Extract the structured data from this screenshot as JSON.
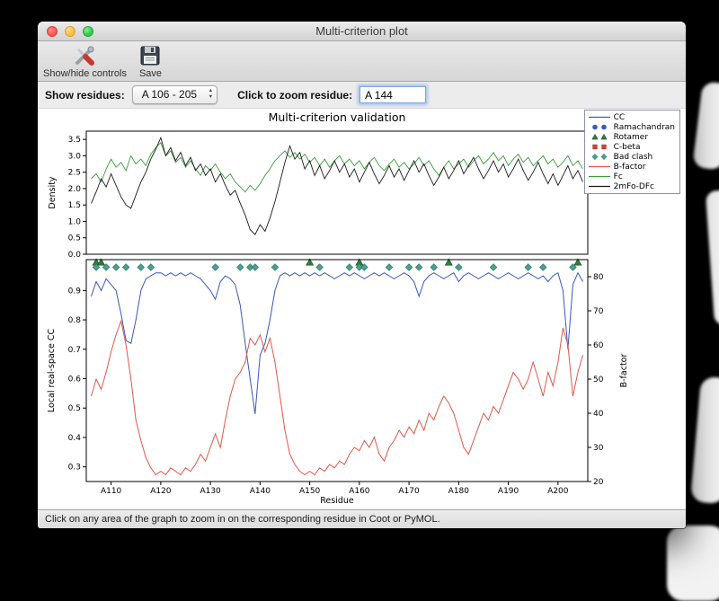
{
  "window": {
    "title": "Multi-criterion plot",
    "toolbar": {
      "show_hide_label": "Show/hide controls",
      "save_label": "Save"
    },
    "controls": {
      "show_residues_label": "Show residues:",
      "residue_range_value": "A 106 - 205",
      "zoom_residue_label": "Click to zoom residue:",
      "zoom_residue_value": "A 144"
    },
    "status_text": "Click on any area of the graph to zoom in on the corresponding residue in Coot or PyMOL."
  },
  "chart_data": {
    "type": "line",
    "title": "Multi-criterion validation",
    "xlabel": "Residue",
    "x_start": 106,
    "xlim": [
      105,
      206
    ],
    "x_ticks": {
      "values": [
        110,
        120,
        130,
        140,
        150,
        160,
        170,
        180,
        190,
        200
      ],
      "labels": [
        "A110",
        "A120",
        "A130",
        "A140",
        "A150",
        "A160",
        "A170",
        "A180",
        "A190",
        "A200"
      ]
    },
    "top_plot": {
      "ylabel": "Density",
      "ylim": [
        0,
        3.75
      ],
      "yticks": [
        "0.0",
        "0.5",
        "1.0",
        "1.5",
        "2.0",
        "2.5",
        "3.0",
        "3.5"
      ],
      "series": [
        {
          "name": "Fc",
          "color": "#3c9a3c",
          "values": [
            2.3,
            2.45,
            2.2,
            2.6,
            2.9,
            2.65,
            2.8,
            2.55,
            3.0,
            2.75,
            2.9,
            2.7,
            3.05,
            3.25,
            3.4,
            3.0,
            3.15,
            2.8,
            2.95,
            2.65,
            2.85,
            2.6,
            2.4,
            2.7,
            2.55,
            2.75,
            2.5,
            2.3,
            2.45,
            2.2,
            2.05,
            1.9,
            2.1,
            1.95,
            2.15,
            2.4,
            2.6,
            2.85,
            3.0,
            3.15,
            2.95,
            3.1,
            2.9,
            3.05,
            2.8,
            2.95,
            2.7,
            2.9,
            2.65,
            2.85,
            3.0,
            2.75,
            2.9,
            2.7,
            2.85,
            2.6,
            2.8,
            2.95,
            2.7,
            2.55,
            2.75,
            2.9,
            2.65,
            2.8,
            2.6,
            2.75,
            2.95,
            2.7,
            2.85,
            2.6,
            2.4,
            2.65,
            2.85,
            2.6,
            2.75,
            2.9,
            2.65,
            2.85,
            3.0,
            2.75,
            2.9,
            3.1,
            2.85,
            3.0,
            2.7,
            2.9,
            3.05,
            2.8,
            2.95,
            2.7,
            2.85,
            3.0,
            2.75,
            2.9,
            2.65,
            2.8,
            3.0,
            2.7,
            2.85,
            2.6
          ]
        },
        {
          "name": "2mFo-DFc",
          "color": "#1a1a1a",
          "values": [
            1.55,
            1.9,
            2.3,
            2.05,
            2.45,
            2.1,
            1.75,
            1.5,
            1.4,
            1.8,
            2.2,
            2.5,
            2.9,
            3.2,
            3.55,
            3.0,
            3.25,
            2.85,
            3.1,
            2.7,
            2.95,
            2.55,
            2.75,
            2.4,
            2.6,
            2.2,
            2.45,
            2.1,
            1.8,
            1.95,
            1.55,
            1.2,
            0.75,
            0.6,
            0.9,
            0.7,
            1.1,
            1.6,
            2.2,
            2.8,
            3.3,
            2.9,
            3.1,
            2.6,
            2.85,
            2.4,
            2.7,
            2.3,
            2.55,
            2.85,
            2.5,
            2.75,
            2.35,
            2.6,
            2.2,
            2.5,
            2.8,
            2.45,
            2.15,
            2.4,
            2.7,
            2.35,
            2.6,
            2.25,
            2.55,
            2.85,
            2.5,
            2.75,
            2.4,
            2.1,
            2.35,
            2.65,
            2.3,
            2.55,
            2.85,
            2.45,
            2.7,
            2.95,
            2.6,
            2.3,
            2.55,
            2.85,
            2.5,
            2.75,
            2.35,
            2.6,
            2.9,
            2.55,
            2.25,
            2.5,
            2.8,
            2.45,
            2.15,
            2.45,
            2.1,
            2.4,
            2.7,
            2.3,
            2.55,
            2.2
          ]
        }
      ]
    },
    "bottom_plot": {
      "ylabel_left": "Local real-space CC",
      "ylabel_left_color": "#3a57c4",
      "ylabel_right": "B-factor",
      "ylabel_right_color": "#e0584a",
      "ylim_left": [
        0.25,
        1.005
      ],
      "yticks_left": [
        "0.3",
        "0.4",
        "0.5",
        "0.6",
        "0.7",
        "0.8",
        "0.9"
      ],
      "ylim_right": [
        20,
        85
      ],
      "yticks_right": [
        "20",
        "30",
        "40",
        "50",
        "60",
        "70",
        "80"
      ],
      "series": [
        {
          "name": "CC",
          "axis": "left",
          "color": "#3a57c4",
          "values": [
            0.88,
            0.93,
            0.9,
            0.94,
            0.92,
            0.9,
            0.82,
            0.73,
            0.72,
            0.8,
            0.9,
            0.94,
            0.95,
            0.96,
            0.96,
            0.95,
            0.96,
            0.95,
            0.96,
            0.95,
            0.96,
            0.95,
            0.94,
            0.92,
            0.9,
            0.87,
            0.93,
            0.95,
            0.94,
            0.92,
            0.85,
            0.72,
            0.6,
            0.48,
            0.68,
            0.72,
            0.8,
            0.9,
            0.95,
            0.96,
            0.95,
            0.96,
            0.95,
            0.96,
            0.95,
            0.96,
            0.95,
            0.96,
            0.95,
            0.94,
            0.95,
            0.96,
            0.95,
            0.96,
            0.95,
            0.94,
            0.95,
            0.96,
            0.95,
            0.96,
            0.95,
            0.94,
            0.95,
            0.96,
            0.95,
            0.93,
            0.88,
            0.93,
            0.95,
            0.96,
            0.95,
            0.94,
            0.95,
            0.96,
            0.93,
            0.95,
            0.96,
            0.95,
            0.94,
            0.95,
            0.96,
            0.95,
            0.94,
            0.95,
            0.96,
            0.95,
            0.94,
            0.95,
            0.96,
            0.95,
            0.94,
            0.95,
            0.93,
            0.95,
            0.96,
            0.9,
            0.7,
            0.92,
            0.96,
            0.93
          ]
        },
        {
          "name": "B-factor",
          "axis": "right",
          "color": "#e0584a",
          "values": [
            45,
            50,
            47,
            52,
            58,
            63,
            67,
            60,
            50,
            38,
            32,
            27,
            24,
            22,
            23,
            22,
            24,
            23,
            22,
            24,
            23,
            25,
            28,
            26,
            30,
            34,
            30,
            38,
            45,
            50,
            52,
            55,
            62,
            60,
            63,
            58,
            62,
            55,
            45,
            35,
            28,
            25,
            23,
            22,
            23,
            22,
            24,
            23,
            25,
            24,
            26,
            25,
            28,
            30,
            29,
            32,
            30,
            33,
            28,
            26,
            30,
            32,
            35,
            33,
            36,
            34,
            38,
            35,
            40,
            38,
            42,
            45,
            43,
            40,
            35,
            30,
            28,
            32,
            36,
            40,
            38,
            42,
            40,
            44,
            48,
            52,
            50,
            47,
            50,
            55,
            50,
            45,
            52,
            48,
            55,
            65,
            60,
            45,
            52,
            57
          ]
        }
      ],
      "markers": {
        "ramachandran": {
          "color": "#3a57c4",
          "residues": []
        },
        "rotamer": {
          "color": "#2f7d3a",
          "residues": [
            107,
            108,
            150,
            160,
            178,
            204
          ]
        },
        "cbeta": {
          "color": "#c0453a",
          "residues": []
        },
        "bad_clash": {
          "color": "#49a08f",
          "residues": [
            107,
            109,
            111,
            113,
            116,
            118,
            131,
            136,
            138,
            139,
            143,
            152,
            158,
            160,
            161,
            166,
            170,
            172,
            175,
            180,
            187,
            194,
            197,
            203
          ]
        }
      }
    },
    "legend": [
      {
        "label": "CC",
        "swatch": "line",
        "color": "#3a57c4"
      },
      {
        "label": "Ramachandran",
        "swatch": "circles",
        "color": "#3a57c4"
      },
      {
        "label": "Rotamer",
        "swatch": "triangles",
        "color": "#2f7d3a"
      },
      {
        "label": "C-beta",
        "swatch": "squares",
        "color": "#c0453a"
      },
      {
        "label": "Bad clash",
        "swatch": "diamonds",
        "color": "#49a08f"
      },
      {
        "label": "B-factor",
        "swatch": "line",
        "color": "#e0584a"
      },
      {
        "label": "Fc",
        "swatch": "line",
        "color": "#3c9a3c"
      },
      {
        "label": "2mFo-DFc",
        "swatch": "line",
        "color": "#1a1a1a"
      }
    ]
  }
}
